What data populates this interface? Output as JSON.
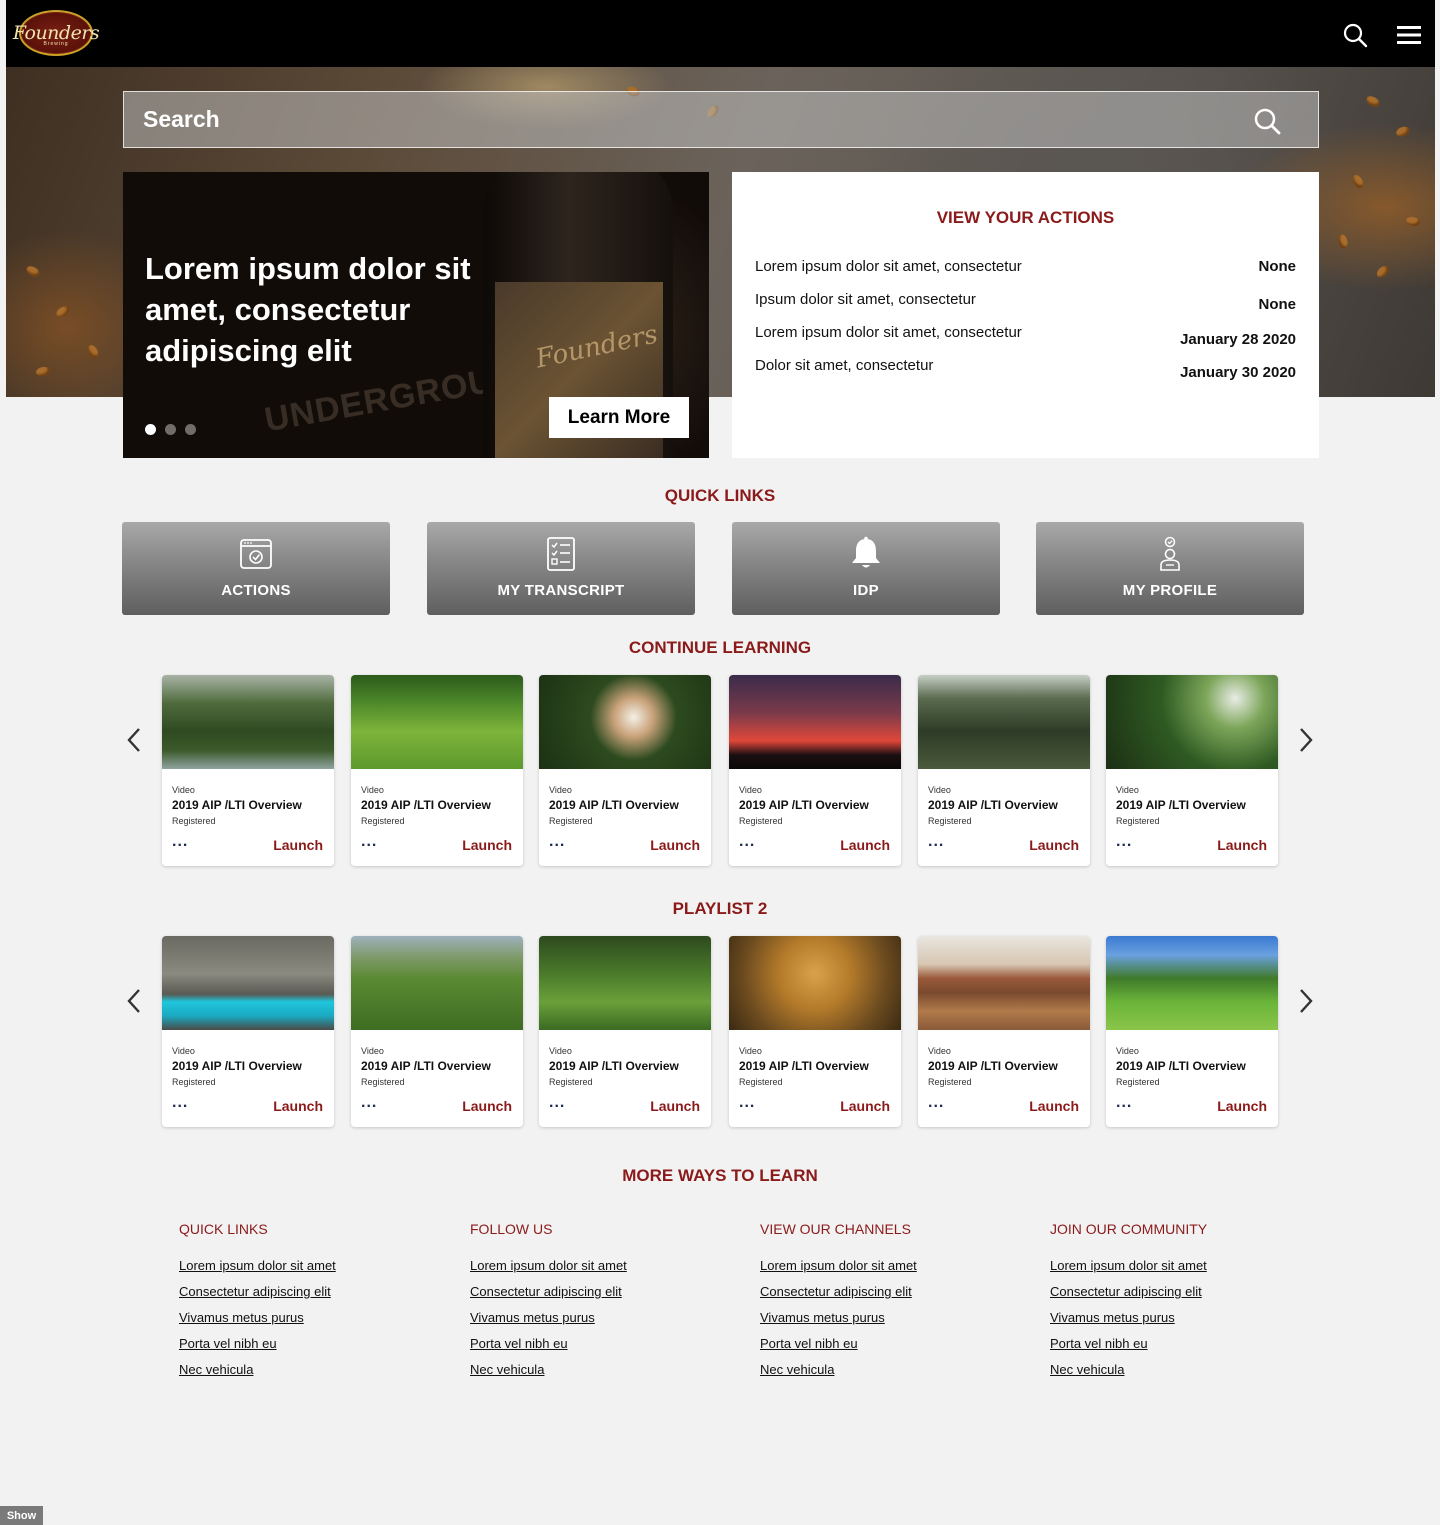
{
  "header": {
    "logo_text": "Founders",
    "logo_subtext": "Brewing",
    "search_icon": "search-icon",
    "menu_icon": "hamburger-menu-icon"
  },
  "search": {
    "placeholder": "Search"
  },
  "banner": {
    "heading": "Lorem ipsum dolor sit amet, consectetur adipiscing elit",
    "button_label": "Learn More",
    "slide_count": 3,
    "active_slide": 1
  },
  "actions": {
    "title": "VIEW YOUR ACTIONS",
    "rows": [
      {
        "label": "Lorem ipsum dolor sit amet, consectetur",
        "value": "None"
      },
      {
        "label": "Ipsum dolor sit amet, consectetur",
        "value": "None"
      },
      {
        "label": "Lorem ipsum dolor sit amet, consectetur",
        "value": "January  28 2020"
      },
      {
        "label": "Dolor sit amet, consectetur",
        "value": "January 30 2020"
      }
    ]
  },
  "quick_links": {
    "title": "QUICK LINKS",
    "items": [
      {
        "label": "ACTIONS",
        "icon": "calendar-check-icon"
      },
      {
        "label": "MY TRANSCRIPT",
        "icon": "checklist-icon"
      },
      {
        "label": "IDP",
        "icon": "bell-icon"
      },
      {
        "label": "MY PROFILE",
        "icon": "user-badge-icon"
      }
    ]
  },
  "continue_learning": {
    "title": "CONTINUE LEARNING",
    "cards": [
      {
        "type": "Video",
        "title": "2019 AIP /LTI Overview",
        "status": "Registered",
        "action": "Launch",
        "more": "...",
        "image": "forest-river-image"
      },
      {
        "type": "Video",
        "title": "2019 AIP /LTI Overview",
        "status": "Registered",
        "action": "Launch",
        "more": "...",
        "image": "tea-field-image"
      },
      {
        "type": "Video",
        "title": "2019 AIP /LTI Overview",
        "status": "Registered",
        "action": "Launch",
        "more": "...",
        "image": "flower-box-image"
      },
      {
        "type": "Video",
        "title": "2019 AIP /LTI Overview",
        "status": "Registered",
        "action": "Launch",
        "more": "...",
        "image": "sunset-trees-image"
      },
      {
        "type": "Video",
        "title": "2019 AIP /LTI Overview",
        "status": "Registered",
        "action": "Launch",
        "more": "...",
        "image": "forest-cabin-image"
      },
      {
        "type": "Video",
        "title": "2019 AIP /LTI Overview",
        "status": "Registered",
        "action": "Launch",
        "more": "...",
        "image": "bird-branch-image"
      }
    ]
  },
  "playlist_2": {
    "title": "PLAYLIST 2",
    "cards": [
      {
        "type": "Video",
        "title": "2019 AIP /LTI Overview",
        "status": "Registered",
        "action": "Launch",
        "more": "...",
        "image": "cliff-lagoon-image"
      },
      {
        "type": "Video",
        "title": "2019 AIP /LTI Overview",
        "status": "Registered",
        "action": "Launch",
        "more": "...",
        "image": "vineyard-image"
      },
      {
        "type": "Video",
        "title": "2019 AIP /LTI Overview",
        "status": "Registered",
        "action": "Launch",
        "more": "...",
        "image": "grass-image"
      },
      {
        "type": "Video",
        "title": "2019 AIP /LTI Overview",
        "status": "Registered",
        "action": "Launch",
        "more": "...",
        "image": "bird-tree-image"
      },
      {
        "type": "Video",
        "title": "2019 AIP /LTI Overview",
        "status": "Registered",
        "action": "Launch",
        "more": "...",
        "image": "desert-butte-image"
      },
      {
        "type": "Video",
        "title": "2019 AIP /LTI Overview",
        "status": "Registered",
        "action": "Launch",
        "more": "...",
        "image": "meadow-trees-image"
      }
    ]
  },
  "more_ways": {
    "title": "MORE WAYS TO LEARN",
    "columns": [
      {
        "heading": "QUICK LINKS",
        "links": [
          "Lorem ipsum dolor sit amet",
          "Consectetur adipiscing elit",
          "Vivamus metus purus",
          "Porta vel nibh eu",
          "Nec vehicula"
        ]
      },
      {
        "heading": "FOLLOW US",
        "links": [
          "Lorem ipsum dolor sit amet",
          "Consectetur adipiscing elit",
          "Vivamus metus purus",
          "Porta vel nibh eu",
          "Nec vehicula"
        ]
      },
      {
        "heading": "VIEW OUR CHANNELS",
        "links": [
          "Lorem ipsum dolor sit amet",
          "Consectetur adipiscing elit",
          "Vivamus metus purus",
          "Porta vel nibh eu",
          "Nec vehicula"
        ]
      },
      {
        "heading": "JOIN OUR COMMUNITY",
        "links": [
          "Lorem ipsum dolor sit amet",
          "Consectetur adipiscing elit",
          "Vivamus metus purus",
          "Porta vel nibh eu",
          "Nec vehicula"
        ]
      }
    ]
  },
  "show_button": {
    "label": "Show"
  },
  "colors": {
    "accent": "#8b1a1a",
    "header_bg": "#000000",
    "page_bg": "#f2f2f2",
    "more_dots": "#1d2b4f"
  }
}
